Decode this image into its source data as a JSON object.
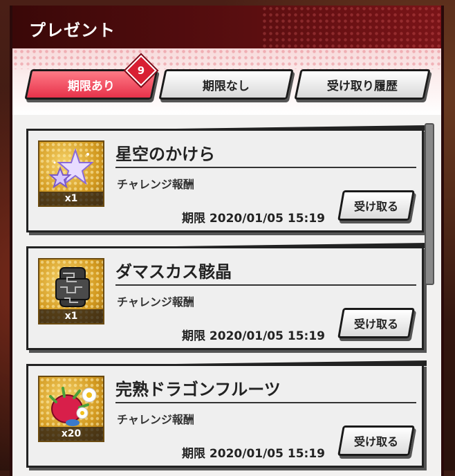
{
  "header": {
    "title": "プレゼント"
  },
  "tabs": [
    {
      "label": "期限あり",
      "active": true,
      "badge": "9"
    },
    {
      "label": "期限なし",
      "active": false
    },
    {
      "label": "受け取り履歴",
      "active": false
    }
  ],
  "items": [
    {
      "name": "星空のかけら",
      "source": "チャレンジ報酬",
      "quantity": "x1",
      "expiry": "期限 2020/01/05 15:19",
      "button": "受け取る",
      "icon": "star-crystal-icon"
    },
    {
      "name": "ダマスカス骸晶",
      "source": "チャレンジ報酬",
      "quantity": "x1",
      "expiry": "期限 2020/01/05 15:19",
      "button": "受け取る",
      "icon": "damascus-ore-icon"
    },
    {
      "name": "完熟ドラゴンフルーツ",
      "source": "チャレンジ報酬",
      "quantity": "x20",
      "expiry": "期限 2020/01/05 15:19",
      "button": "受け取る",
      "icon": "dragon-fruit-icon"
    }
  ],
  "colors": {
    "accent": "#e6324a",
    "header": "#5a0e10"
  }
}
